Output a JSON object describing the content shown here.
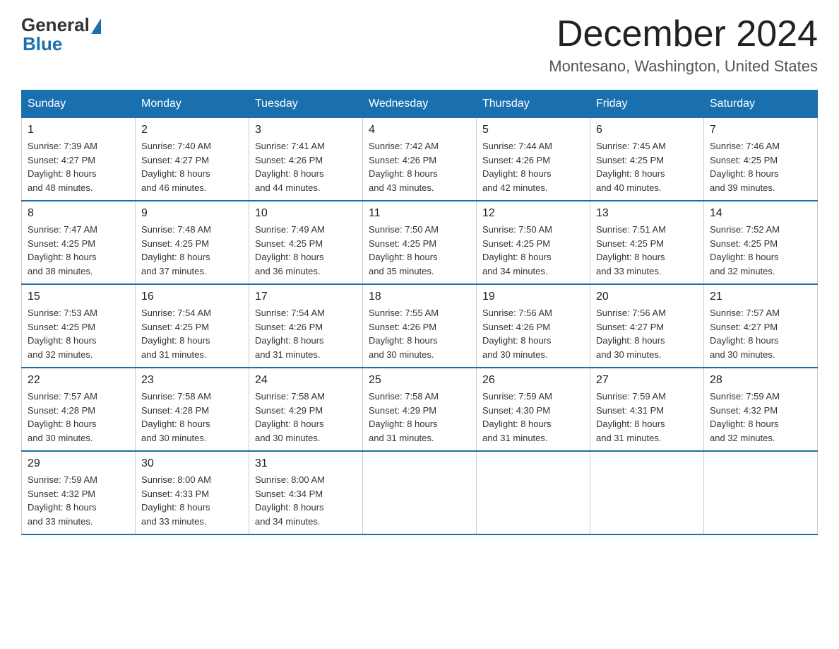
{
  "logo": {
    "general": "General",
    "blue": "Blue"
  },
  "title": {
    "month": "December 2024",
    "location": "Montesano, Washington, United States"
  },
  "headers": [
    "Sunday",
    "Monday",
    "Tuesday",
    "Wednesday",
    "Thursday",
    "Friday",
    "Saturday"
  ],
  "weeks": [
    [
      {
        "day": "1",
        "sunrise": "7:39 AM",
        "sunset": "4:27 PM",
        "daylight": "8 hours and 48 minutes."
      },
      {
        "day": "2",
        "sunrise": "7:40 AM",
        "sunset": "4:27 PM",
        "daylight": "8 hours and 46 minutes."
      },
      {
        "day": "3",
        "sunrise": "7:41 AM",
        "sunset": "4:26 PM",
        "daylight": "8 hours and 44 minutes."
      },
      {
        "day": "4",
        "sunrise": "7:42 AM",
        "sunset": "4:26 PM",
        "daylight": "8 hours and 43 minutes."
      },
      {
        "day": "5",
        "sunrise": "7:44 AM",
        "sunset": "4:26 PM",
        "daylight": "8 hours and 42 minutes."
      },
      {
        "day": "6",
        "sunrise": "7:45 AM",
        "sunset": "4:25 PM",
        "daylight": "8 hours and 40 minutes."
      },
      {
        "day": "7",
        "sunrise": "7:46 AM",
        "sunset": "4:25 PM",
        "daylight": "8 hours and 39 minutes."
      }
    ],
    [
      {
        "day": "8",
        "sunrise": "7:47 AM",
        "sunset": "4:25 PM",
        "daylight": "8 hours and 38 minutes."
      },
      {
        "day": "9",
        "sunrise": "7:48 AM",
        "sunset": "4:25 PM",
        "daylight": "8 hours and 37 minutes."
      },
      {
        "day": "10",
        "sunrise": "7:49 AM",
        "sunset": "4:25 PM",
        "daylight": "8 hours and 36 minutes."
      },
      {
        "day": "11",
        "sunrise": "7:50 AM",
        "sunset": "4:25 PM",
        "daylight": "8 hours and 35 minutes."
      },
      {
        "day": "12",
        "sunrise": "7:50 AM",
        "sunset": "4:25 PM",
        "daylight": "8 hours and 34 minutes."
      },
      {
        "day": "13",
        "sunrise": "7:51 AM",
        "sunset": "4:25 PM",
        "daylight": "8 hours and 33 minutes."
      },
      {
        "day": "14",
        "sunrise": "7:52 AM",
        "sunset": "4:25 PM",
        "daylight": "8 hours and 32 minutes."
      }
    ],
    [
      {
        "day": "15",
        "sunrise": "7:53 AM",
        "sunset": "4:25 PM",
        "daylight": "8 hours and 32 minutes."
      },
      {
        "day": "16",
        "sunrise": "7:54 AM",
        "sunset": "4:25 PM",
        "daylight": "8 hours and 31 minutes."
      },
      {
        "day": "17",
        "sunrise": "7:54 AM",
        "sunset": "4:26 PM",
        "daylight": "8 hours and 31 minutes."
      },
      {
        "day": "18",
        "sunrise": "7:55 AM",
        "sunset": "4:26 PM",
        "daylight": "8 hours and 30 minutes."
      },
      {
        "day": "19",
        "sunrise": "7:56 AM",
        "sunset": "4:26 PM",
        "daylight": "8 hours and 30 minutes."
      },
      {
        "day": "20",
        "sunrise": "7:56 AM",
        "sunset": "4:27 PM",
        "daylight": "8 hours and 30 minutes."
      },
      {
        "day": "21",
        "sunrise": "7:57 AM",
        "sunset": "4:27 PM",
        "daylight": "8 hours and 30 minutes."
      }
    ],
    [
      {
        "day": "22",
        "sunrise": "7:57 AM",
        "sunset": "4:28 PM",
        "daylight": "8 hours and 30 minutes."
      },
      {
        "day": "23",
        "sunrise": "7:58 AM",
        "sunset": "4:28 PM",
        "daylight": "8 hours and 30 minutes."
      },
      {
        "day": "24",
        "sunrise": "7:58 AM",
        "sunset": "4:29 PM",
        "daylight": "8 hours and 30 minutes."
      },
      {
        "day": "25",
        "sunrise": "7:58 AM",
        "sunset": "4:29 PM",
        "daylight": "8 hours and 31 minutes."
      },
      {
        "day": "26",
        "sunrise": "7:59 AM",
        "sunset": "4:30 PM",
        "daylight": "8 hours and 31 minutes."
      },
      {
        "day": "27",
        "sunrise": "7:59 AM",
        "sunset": "4:31 PM",
        "daylight": "8 hours and 31 minutes."
      },
      {
        "day": "28",
        "sunrise": "7:59 AM",
        "sunset": "4:32 PM",
        "daylight": "8 hours and 32 minutes."
      }
    ],
    [
      {
        "day": "29",
        "sunrise": "7:59 AM",
        "sunset": "4:32 PM",
        "daylight": "8 hours and 33 minutes."
      },
      {
        "day": "30",
        "sunrise": "8:00 AM",
        "sunset": "4:33 PM",
        "daylight": "8 hours and 33 minutes."
      },
      {
        "day": "31",
        "sunrise": "8:00 AM",
        "sunset": "4:34 PM",
        "daylight": "8 hours and 34 minutes."
      },
      null,
      null,
      null,
      null
    ]
  ],
  "labels": {
    "sunrise": "Sunrise:",
    "sunset": "Sunset:",
    "daylight": "Daylight:"
  }
}
